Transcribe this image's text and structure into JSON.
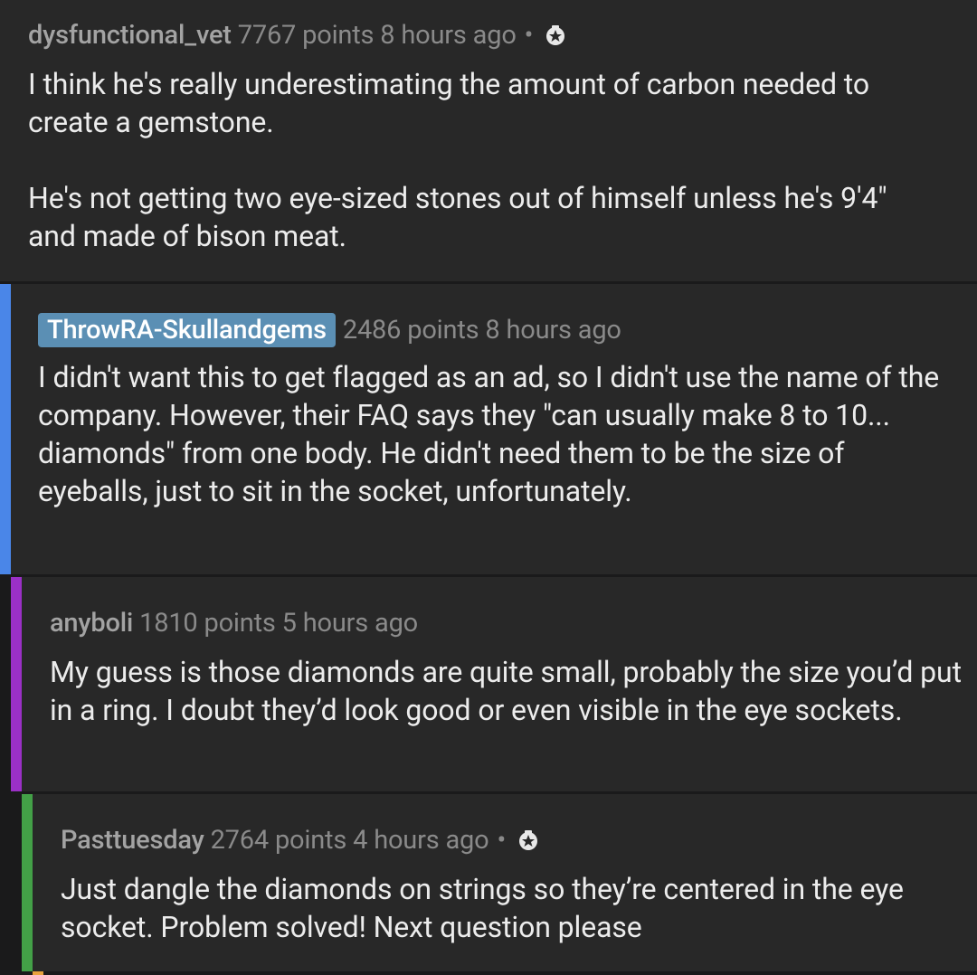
{
  "comments": [
    {
      "author": "dysfunctional_vet",
      "meta_rest": " 7767 points 8 hours ago",
      "award": "award-icon",
      "body": "I think he's really underestimating the amount of carbon needed to create a gemstone.\n\nHe's not getting two eye-sized stones out of himself unless he's 9'4\" and made of bison meat."
    },
    {
      "author": "ThrowRA-Skullandgems",
      "meta_rest": "2486 points 8 hours ago",
      "depth_color": "#4a86e8",
      "body": "I didn't want this to get flagged as an ad, so I didn't use the name of the company. However, their FAQ says they \"can usually make 8 to 10... diamonds\" from one body. He didn't need them to be the size of eyeballs, just to sit in the socket, unfortunately."
    },
    {
      "author": "anyboli",
      "meta_rest": " 1810 points 5 hours ago",
      "depth_color": "#9b30c6",
      "body": "My guess is those diamonds are quite small, probably the size you’d put in a ring. I doubt they’d look good or even visible in the eye sockets."
    },
    {
      "author": "Pasttuesday",
      "meta_rest": " 2764 points 4 hours ago",
      "award": "award-icon",
      "depth_color": "#43a047",
      "body": "Just dangle the diamonds on strings so they’re centered in the eye socket. Problem solved! Next question please"
    }
  ],
  "separator_dot": "•"
}
